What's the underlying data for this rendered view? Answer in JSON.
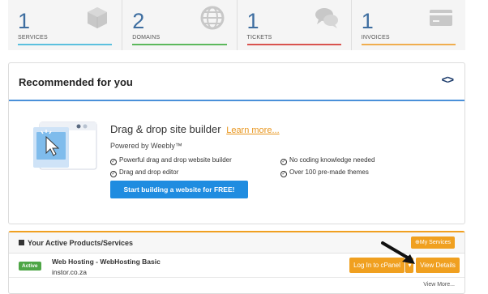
{
  "stats": [
    {
      "count": "1",
      "label": "SERVICES",
      "color": "#5bc0de",
      "icon": "box-icon"
    },
    {
      "count": "2",
      "label": "DOMAINS",
      "color": "#5cb85c",
      "icon": "globe-icon"
    },
    {
      "count": "1",
      "label": "TICKETS",
      "color": "#d9534f",
      "icon": "chat-bubbles-icon"
    },
    {
      "count": "1",
      "label": "INVOICES",
      "color": "#f0ad4e",
      "icon": "credit-card-icon"
    }
  ],
  "recommended": {
    "title": "Recommended for you",
    "promo": {
      "title": "Drag & drop site builder",
      "learn_more": "Learn more...",
      "powered_by": "Powered by Weebly™",
      "features_left": [
        "Powerful drag and drop website builder",
        "Drag and drop editor"
      ],
      "features_right": [
        "No coding knowledge needed",
        "Over 100 pre-made themes"
      ],
      "cta": "Start building a website for FREE!"
    }
  },
  "active_products": {
    "title": "Your Active Products/Services",
    "my_services_label": "My Services",
    "items": [
      {
        "status": "Active",
        "name": "Web Hosting - WebHosting Basic",
        "domain": "instor.co.za",
        "login_label": "Log In to cPanel",
        "details_label": "View Details"
      }
    ],
    "view_more": "View More..."
  }
}
